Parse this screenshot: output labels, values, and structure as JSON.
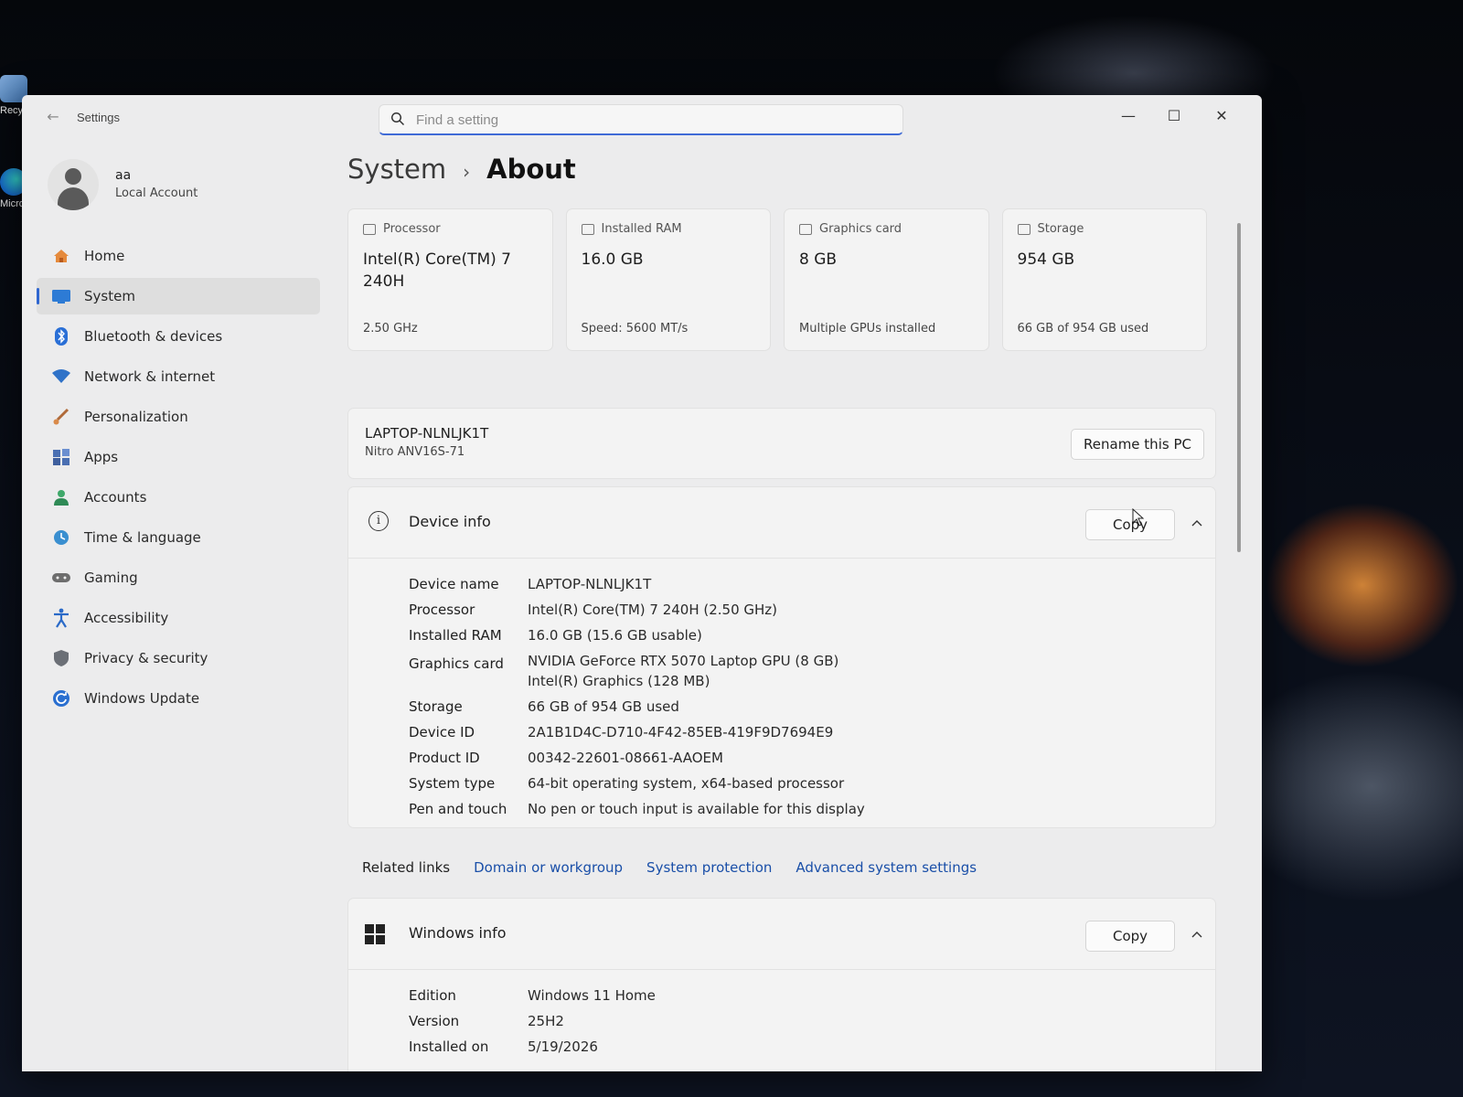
{
  "desktop": {
    "icons": [
      {
        "label": "Recycle"
      },
      {
        "label": "Microsoft Edge"
      }
    ]
  },
  "window": {
    "title": "Settings",
    "search": {
      "placeholder": "Find a setting",
      "value": ""
    },
    "controls": {
      "minimize": "—",
      "maximize": "☐",
      "close": "✕"
    }
  },
  "profile": {
    "name": "aa",
    "account_type": "Local Account"
  },
  "nav": [
    {
      "label": "Home",
      "icon": "home-icon"
    },
    {
      "label": "System",
      "icon": "monitor-icon",
      "active": true
    },
    {
      "label": "Bluetooth & devices",
      "icon": "bluetooth-icon"
    },
    {
      "label": "Network & internet",
      "icon": "wifi-icon"
    },
    {
      "label": "Personalization",
      "icon": "brush-icon"
    },
    {
      "label": "Apps",
      "icon": "apps-icon"
    },
    {
      "label": "Accounts",
      "icon": "person-icon"
    },
    {
      "label": "Time & language",
      "icon": "globe-clock-icon"
    },
    {
      "label": "Gaming",
      "icon": "gamepad-icon"
    },
    {
      "label": "Accessibility",
      "icon": "accessibility-icon"
    },
    {
      "label": "Privacy & security",
      "icon": "shield-icon"
    },
    {
      "label": "Windows Update",
      "icon": "refresh-icon"
    }
  ],
  "breadcrumb": {
    "parent": "System",
    "separator": "›",
    "current": "About"
  },
  "specs": [
    {
      "label": "Processor",
      "value": "Intel(R) Core(TM) 7 240H",
      "sub": "2.50 GHz",
      "icon": "processor-icon"
    },
    {
      "label": "Installed RAM",
      "value": "16.0 GB",
      "sub": "Speed: 5600 MT/s",
      "icon": "ram-icon"
    },
    {
      "label": "Graphics card",
      "value": "8 GB",
      "sub": "Multiple GPUs installed",
      "icon": "gpu-icon"
    },
    {
      "label": "Storage",
      "value": "954 GB",
      "sub": "66 GB of 954 GB used",
      "icon": "storage-icon"
    }
  ],
  "pc": {
    "name": "LAPTOP-NLNLJK1T",
    "model": "Nitro ANV16S-71",
    "rename_label": "Rename this PC"
  },
  "device_info": {
    "title": "Device info",
    "copy_label": "Copy",
    "rows": [
      {
        "key": "Device name",
        "values": [
          "LAPTOP-NLNLJK1T"
        ]
      },
      {
        "key": "Processor",
        "values": [
          "Intel(R) Core(TM) 7 240H (2.50 GHz)"
        ]
      },
      {
        "key": "Installed RAM",
        "values": [
          "16.0 GB (15.6 GB usable)"
        ]
      },
      {
        "key": "Graphics card",
        "values": [
          "NVIDIA GeForce RTX 5070 Laptop GPU (8 GB)",
          "Intel(R) Graphics (128 MB)"
        ]
      },
      {
        "key": "Storage",
        "values": [
          "66 GB of 954 GB used"
        ]
      },
      {
        "key": "Device ID",
        "values": [
          "2A1B1D4C-D710-4F42-85EB-419F9D7694E9"
        ]
      },
      {
        "key": "Product ID",
        "values": [
          "00342-22601-08661-AAOEM"
        ]
      },
      {
        "key": "System type",
        "values": [
          "64-bit operating system, x64-based processor"
        ]
      },
      {
        "key": "Pen and touch",
        "values": [
          "No pen or touch input is available for this display"
        ]
      }
    ]
  },
  "related_links": {
    "title": "Related links",
    "links": [
      "Domain or workgroup",
      "System protection",
      "Advanced system settings"
    ]
  },
  "windows_info": {
    "title": "Windows info",
    "copy_label": "Copy",
    "rows": [
      {
        "key": "Edition",
        "values": [
          "Windows 11 Home"
        ]
      },
      {
        "key": "Version",
        "values": [
          "25H2"
        ]
      },
      {
        "key": "Installed on",
        "values": [
          "5/19/2026"
        ]
      }
    ]
  },
  "colors": {
    "accent": "#2f66d0",
    "link": "#1a4fa8",
    "window_bg": "#ececed"
  }
}
